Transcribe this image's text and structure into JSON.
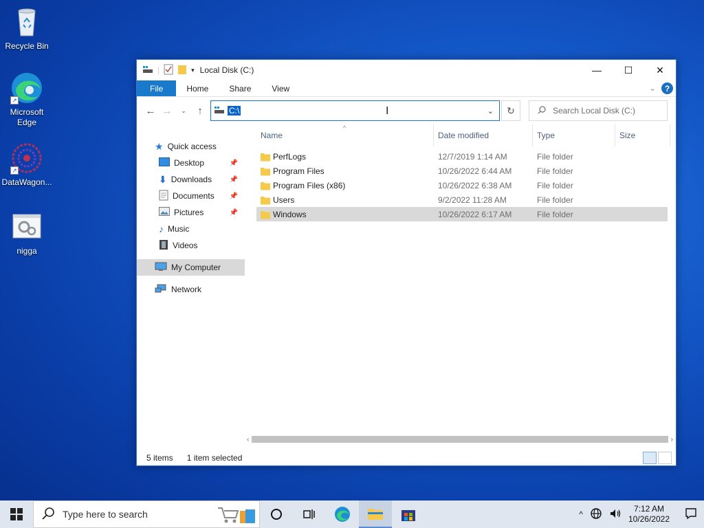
{
  "desktop": {
    "icons": [
      {
        "label": "Recycle Bin"
      },
      {
        "label": "Microsoft Edge"
      },
      {
        "label": "DataWagon..."
      },
      {
        "label": "nigga"
      }
    ]
  },
  "window": {
    "title": "Local Disk (C:)",
    "ribbon": {
      "file": "File",
      "home": "Home",
      "share": "Share",
      "view": "View",
      "help": "?"
    },
    "address": {
      "path": "C:\\"
    },
    "search": {
      "placeholder": "Search Local Disk (C:)"
    },
    "sidebar": {
      "items": [
        {
          "label": "Quick access"
        },
        {
          "label": "Desktop"
        },
        {
          "label": "Downloads"
        },
        {
          "label": "Documents"
        },
        {
          "label": "Pictures"
        },
        {
          "label": "Music"
        },
        {
          "label": "Videos"
        },
        {
          "label": "My Computer"
        },
        {
          "label": "Network"
        }
      ]
    },
    "columns": {
      "name": "Name",
      "date": "Date modified",
      "type": "Type",
      "size": "Size"
    },
    "files": [
      {
        "name": "PerfLogs",
        "date": "12/7/2019 1:14 AM",
        "type": "File folder"
      },
      {
        "name": "Program Files",
        "date": "10/26/2022 6:44 AM",
        "type": "File folder"
      },
      {
        "name": "Program Files (x86)",
        "date": "10/26/2022 6:38 AM",
        "type": "File folder"
      },
      {
        "name": "Users",
        "date": "9/2/2022 11:28 AM",
        "type": "File folder"
      },
      {
        "name": "Windows",
        "date": "10/26/2022 6:17 AM",
        "type": "File folder"
      }
    ],
    "status": {
      "items": "5 items",
      "selected": "1 item selected"
    }
  },
  "taskbar": {
    "search_placeholder": "Type here to search",
    "time": "7:12 AM",
    "date": "10/26/2022"
  },
  "colors": {
    "accent": "#1979ca",
    "folder": "#f5c94a",
    "selection": "#d9d9d9"
  }
}
